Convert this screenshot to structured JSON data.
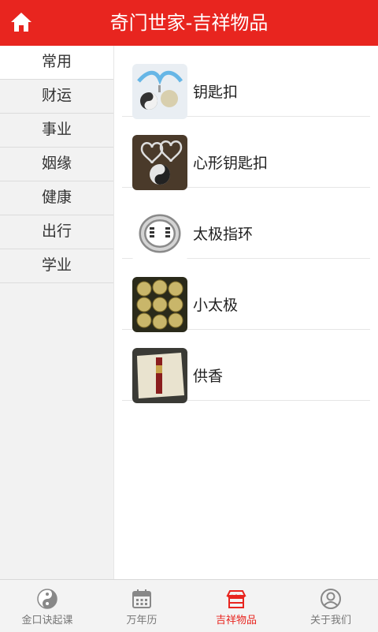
{
  "header": {
    "title": "奇门世家-吉祥物品"
  },
  "sidebar": {
    "items": [
      {
        "label": "常用"
      },
      {
        "label": "财运"
      },
      {
        "label": "事业"
      },
      {
        "label": "姻缘"
      },
      {
        "label": "健康"
      },
      {
        "label": "出行"
      },
      {
        "label": "学业"
      }
    ]
  },
  "list": {
    "items": [
      {
        "label": "钥匙扣"
      },
      {
        "label": "心形钥匙扣"
      },
      {
        "label": "太极指环"
      },
      {
        "label": "小太极"
      },
      {
        "label": "供香"
      }
    ]
  },
  "tabbar": {
    "tabs": [
      {
        "label": "金口诀起课"
      },
      {
        "label": "万年历"
      },
      {
        "label": "吉祥物品"
      },
      {
        "label": "关于我们"
      }
    ]
  },
  "colors": {
    "accent": "#e8251f"
  }
}
